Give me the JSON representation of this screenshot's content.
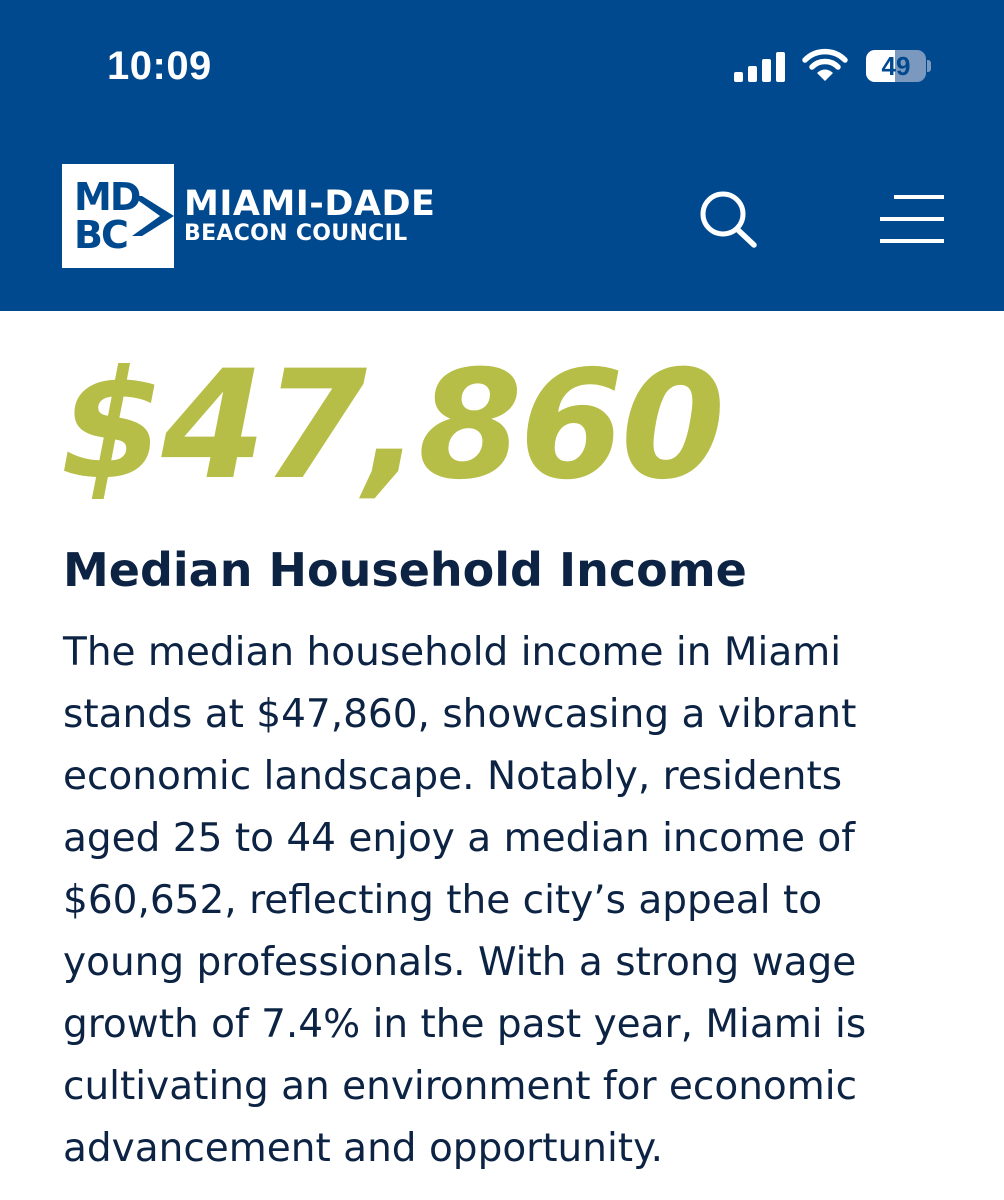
{
  "status_bar": {
    "time": "10:09",
    "battery_level": "49",
    "battery_fraction": 0.49,
    "icons": [
      "cellular-signal-icon",
      "wifi-icon",
      "battery-icon"
    ]
  },
  "header": {
    "background_color": "#01498f",
    "logo": {
      "monogram_line1": "MD",
      "monogram_line2": "BC",
      "name": "MIAMI-DADE",
      "subname": "BEACON COUNCIL"
    },
    "icons": [
      "search-icon",
      "hamburger-menu-icon"
    ]
  },
  "stat": {
    "value": "$47,860",
    "value_color": "#b6be47",
    "title": "Median Household Income",
    "body": "The median household income in Miami stands at $47,860, showcasing a vibrant economic landscape. Notably, residents aged 25 to 44 enjoy a median income of $60,652, reflecting the city’s appeal to young professionals. With a strong wage growth of 7.4% in the past year, Miami is cultivating an environment for economic advancement and opportunity."
  }
}
